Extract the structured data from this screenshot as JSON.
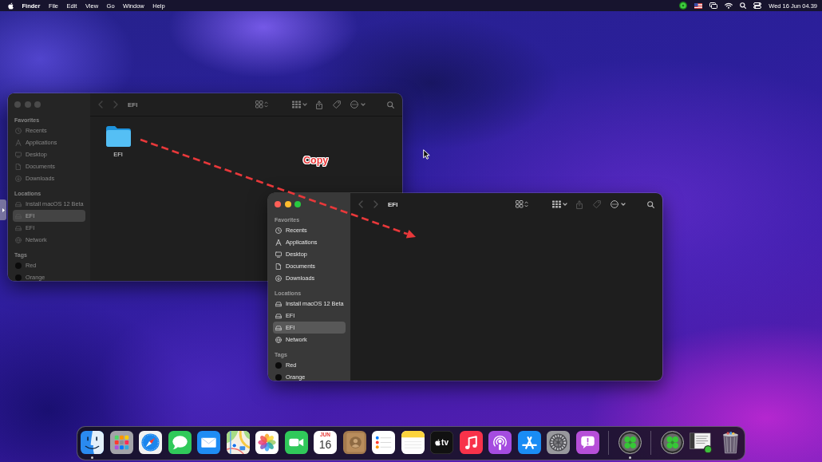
{
  "menu_bar": {
    "app_menu": "Finder",
    "menus": [
      "File",
      "Edit",
      "View",
      "Go",
      "Window",
      "Help"
    ],
    "clock": "Wed 16 Jun 04.39"
  },
  "windows": [
    {
      "active": false,
      "title": "EFI",
      "navigation": [
        {
          "disabled": true
        },
        {
          "disabled": true
        }
      ],
      "tools": [
        {
          "disabled": false
        },
        {
          "disabled": false
        },
        {
          "disabled": false
        },
        {
          "disabled": false
        },
        {
          "disabled": false
        },
        {
          "disabled": false
        }
      ],
      "sidebar": [
        {
          "header": "Favorites",
          "items": [
            {
              "label": "Recents",
              "selected": false
            },
            {
              "label": "Applications",
              "selected": false
            },
            {
              "label": "Desktop",
              "selected": false
            },
            {
              "label": "Documents",
              "selected": false
            },
            {
              "label": "Downloads",
              "selected": false
            }
          ]
        },
        {
          "header": "Locations",
          "items": [
            {
              "label": "Install macOS 12 Beta",
              "selected": false
            },
            {
              "label": "EFI",
              "selected": true
            },
            {
              "label": "EFI",
              "selected": false
            },
            {
              "label": "Network",
              "selected": false
            }
          ]
        },
        {
          "header": "Tags",
          "items": [
            {
              "label": "Red",
              "selected": false
            },
            {
              "label": "Orange",
              "selected": false
            }
          ]
        }
      ],
      "files": [
        {
          "name": "EFI"
        }
      ]
    },
    {
      "active": true,
      "title": "EFI",
      "navigation": [
        {
          "disabled": true
        },
        {
          "disabled": true
        }
      ],
      "tools": [
        {
          "disabled": false
        },
        {
          "disabled": false
        },
        {
          "disabled": true
        },
        {
          "disabled": true
        },
        {
          "disabled": false
        },
        {
          "disabled": false
        }
      ],
      "sidebar": [
        {
          "header": "Favorites",
          "items": [
            {
              "label": "Recents",
              "selected": false
            },
            {
              "label": "Applications",
              "selected": false
            },
            {
              "label": "Desktop",
              "selected": false
            },
            {
              "label": "Documents",
              "selected": false
            },
            {
              "label": "Downloads",
              "selected": false
            }
          ]
        },
        {
          "header": "Locations",
          "items": [
            {
              "label": "Install macOS 12 Beta",
              "selected": false
            },
            {
              "label": "EFI",
              "selected": false
            },
            {
              "label": "EFI",
              "selected": true
            },
            {
              "label": "Network",
              "selected": false
            }
          ]
        },
        {
          "header": "Tags",
          "items": [
            {
              "label": "Red",
              "selected": false
            },
            {
              "label": "Orange",
              "selected": false
            }
          ]
        }
      ]
    }
  ],
  "annotation": {
    "label": "Copy"
  },
  "dock": {
    "sections": [
      [
        {
          "running": true
        },
        {
          "running": false
        },
        {
          "running": false
        },
        {
          "running": false
        },
        {
          "running": false
        },
        {
          "running": false
        },
        {
          "running": false
        },
        {
          "running": false
        },
        {
          "running": false,
          "month": "JUN",
          "day": "16"
        },
        {
          "running": false
        },
        {
          "running": false
        },
        {
          "running": false
        },
        {
          "running": false,
          "caption": "tv"
        },
        {
          "running": false
        },
        {
          "running": false
        },
        {
          "running": false
        },
        {
          "running": false
        },
        {
          "running": false
        }
      ],
      [
        {
          "running": true
        }
      ],
      [
        {
          "running": false
        },
        {
          "running": false
        },
        {
          "running": false
        }
      ]
    ]
  }
}
